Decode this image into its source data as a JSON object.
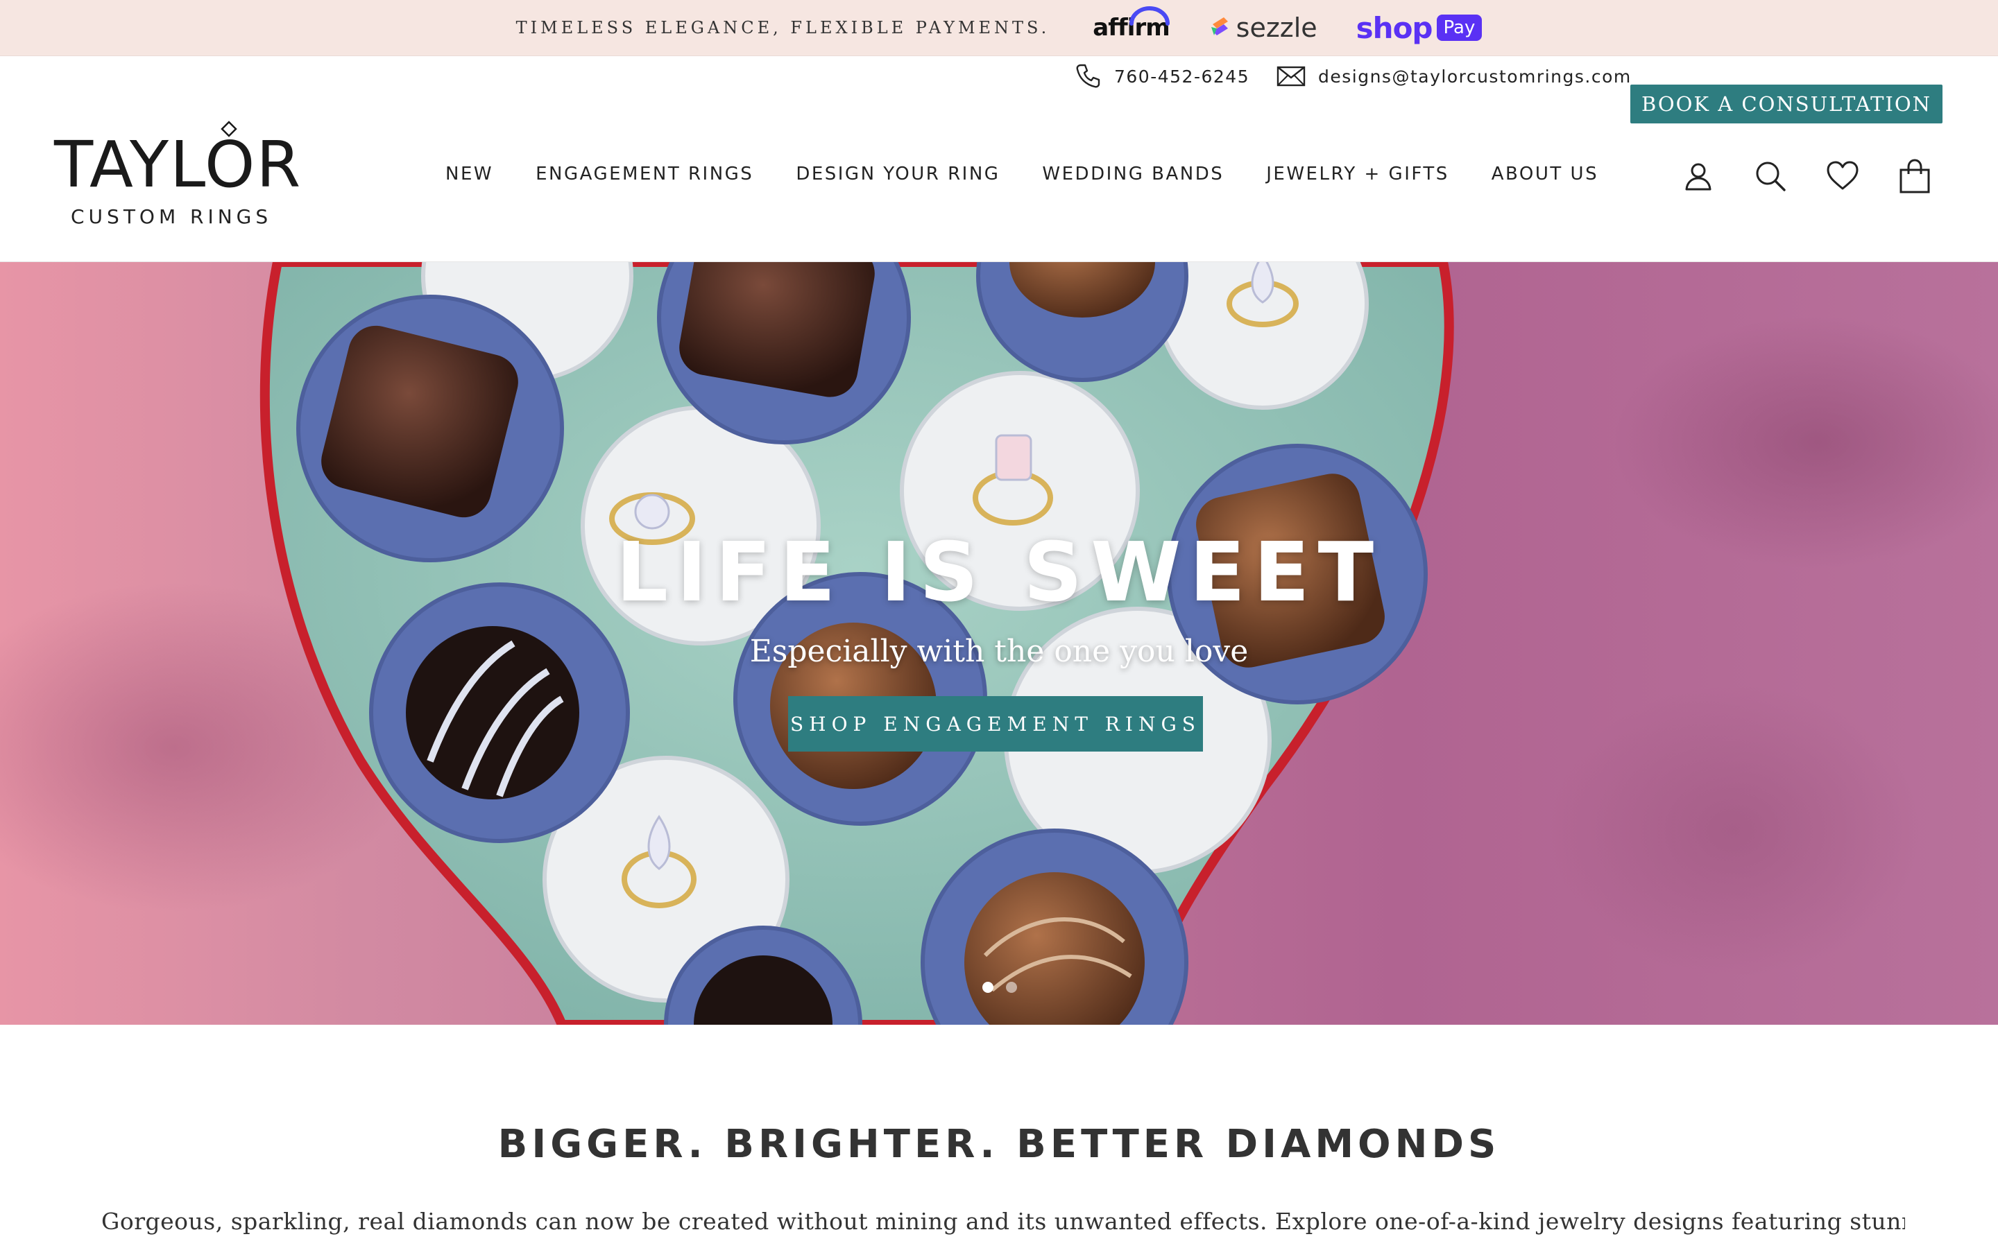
{
  "announcement": {
    "text": "TIMELESS ELEGANCE, FLEXIBLE PAYMENTS.",
    "payment_logos": [
      "affirm",
      "sezzle",
      "shop",
      "Pay"
    ]
  },
  "brand": {
    "name": "TAYLOR",
    "tagline": "CUSTOM RINGS"
  },
  "contact": {
    "phone": "760-452-6245",
    "email": "designs@taylorcustomrings.com",
    "cta": "BOOK A CONSULTATION"
  },
  "nav": {
    "items": [
      "NEW",
      "ENGAGEMENT RINGS",
      "DESIGN YOUR RING",
      "WEDDING BANDS",
      "JEWELRY + GIFTS",
      "ABOUT US"
    ]
  },
  "header_icons": [
    "account-icon",
    "search-icon",
    "heart-icon",
    "bag-icon"
  ],
  "hero": {
    "title": "LIFE IS SWEET",
    "subtitle": "Especially with the one you love",
    "button": "SHOP ENGAGEMENT RINGS",
    "slides": 2,
    "active_slide": 1
  },
  "intro": {
    "title": "BIGGER. BRIGHTER. BETTER DIAMONDS",
    "text": "Gorgeous, sparkling, real diamonds can now be created without mining and its unwanted effects. Explore one-of-a-kind jewelry designs featuring stunning mine-free"
  },
  "colors": {
    "accent": "#2e7d80",
    "announcement_bg": "#f6e6e1",
    "shop_pay": "#5a31f4"
  }
}
